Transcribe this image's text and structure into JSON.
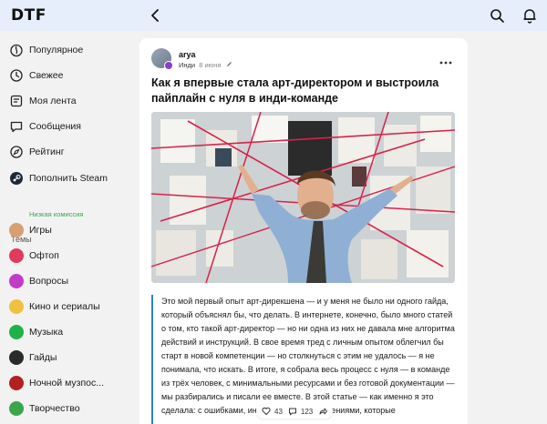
{
  "header": {
    "logo": "DTF"
  },
  "sidebar": {
    "items": [
      {
        "label": "Популярное",
        "icon": "flame-icon"
      },
      {
        "label": "Свежее",
        "icon": "clock-icon"
      },
      {
        "label": "Моя лента",
        "icon": "feed-icon"
      },
      {
        "label": "Сообщения",
        "icon": "chat-icon"
      },
      {
        "label": "Рейтинг",
        "icon": "compass-icon"
      },
      {
        "label": "Пополнить Steam",
        "sub": "Низкая комиссия",
        "icon": "steam-icon"
      }
    ],
    "topics_label": "Темы",
    "topics": [
      {
        "label": "Игры",
        "color": "#d8a070"
      },
      {
        "label": "Офтоп",
        "color": "#e23a5a"
      },
      {
        "label": "Вопросы",
        "color": "#c43ac8"
      },
      {
        "label": "Кино и сериалы",
        "color": "#f0c040"
      },
      {
        "label": "Музыка",
        "color": "#1fb24a"
      },
      {
        "label": "Гайды",
        "color": "#2a2a2a"
      },
      {
        "label": "Ночной музпос...",
        "color": "#b22020"
      },
      {
        "label": "Творчество",
        "color": "#3aa64a"
      }
    ]
  },
  "post": {
    "author": "arya",
    "community": "Инди",
    "date": "8 июня",
    "title": "Как я впервые стала арт-директором и выстроила пайплайн с нуля в инди-команде",
    "body": "Это мой первый опыт арт-дирекшена — и у меня не было ни одного гайда, который объяснял бы, что делать. В интернете, конечно, было много статей о том, кто такой арт-директор — но ни одна из них не давала мне алгоритма действий и инструкций. В свое время тред с личным опытом облегчил бы старт в новой компетенции — но столкнуться с этим не удалось — я не понимала, что искать. В итоге, я собрала весь процесс с нуля — в команде из трёх человек, с минимальными ресурсами и без готовой документации — мы разбирались и писали ее вместе. В этой статье — как именно я это сделала: с ошибками, инструментами и решениями, которые",
    "likes": "43",
    "comments": "123"
  },
  "colors": {
    "accent": "#2f7fd6",
    "topbar": "#e6eefb",
    "steam_sub": "#3aa64a"
  }
}
